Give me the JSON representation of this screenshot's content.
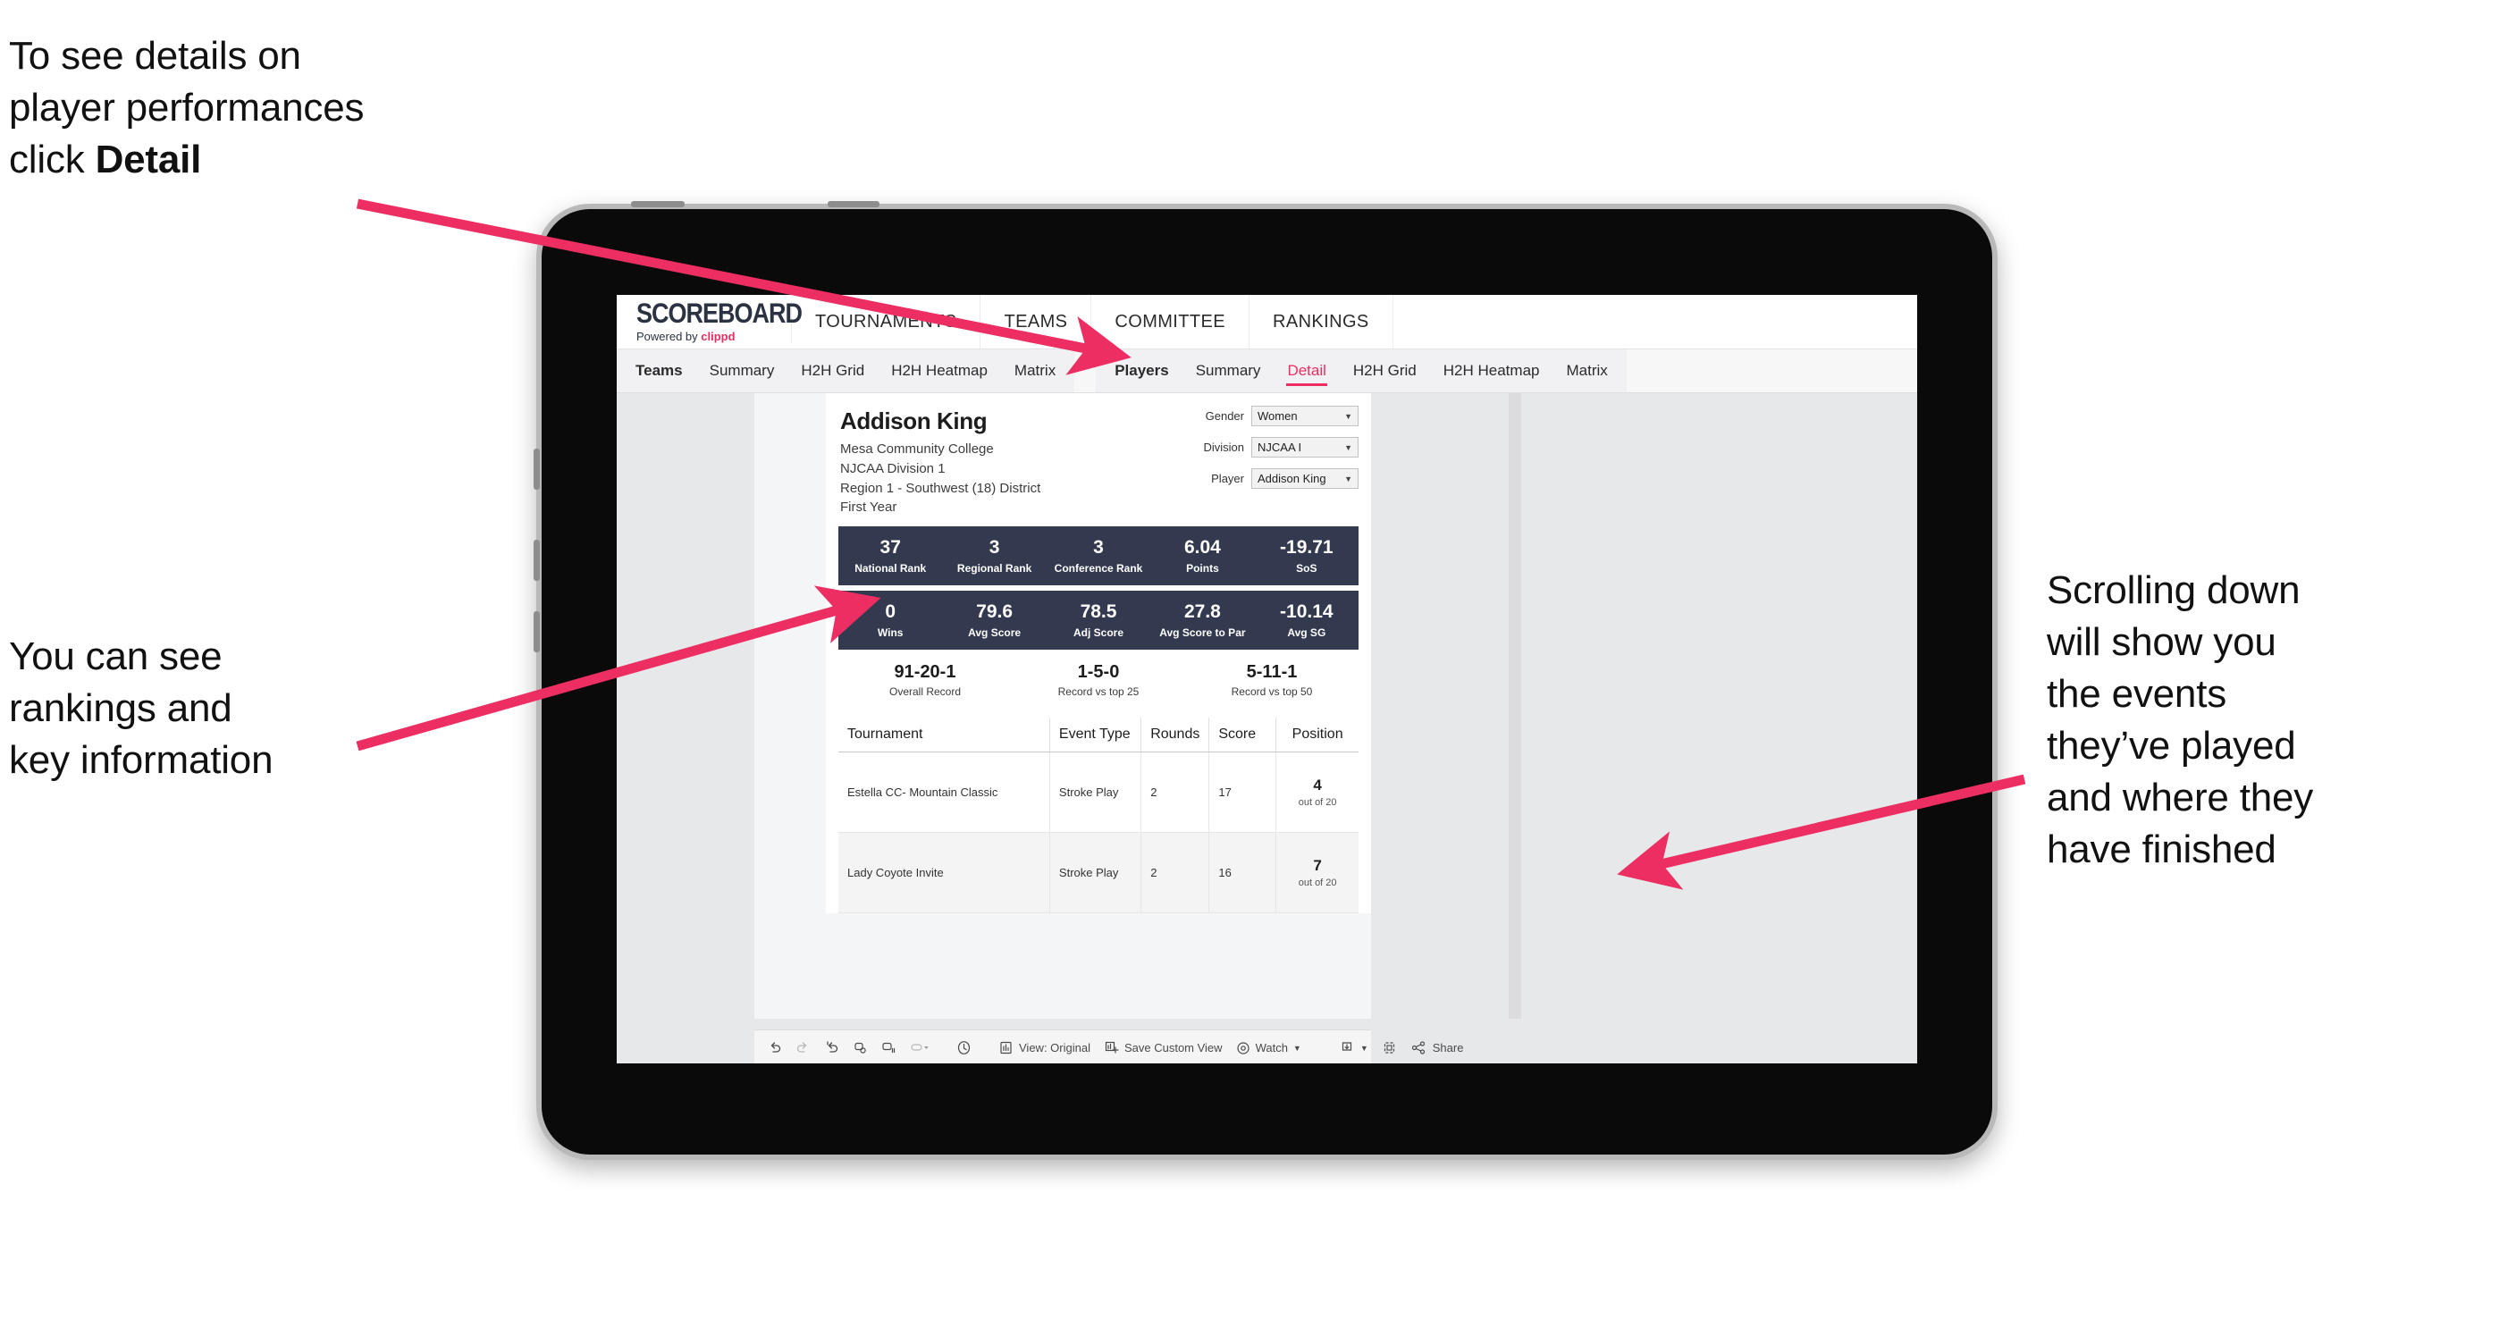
{
  "annotations": {
    "top_left": {
      "line1": "To see details on",
      "line2": "player performances",
      "line3_pre": "click ",
      "line3_bold": "Detail"
    },
    "bottom_left": {
      "line1": "You can see",
      "line2": "rankings and",
      "line3": "key information"
    },
    "right": {
      "line1": "Scrolling down",
      "line2": "will show you",
      "line3": "the events",
      "line4": "they’ve played",
      "line5": "and where they",
      "line6": "have finished"
    }
  },
  "colors": {
    "accent_pink": "#ec2e62",
    "stat_bar_navy": "#333a4f",
    "screen_bg": "#e7e8ea"
  },
  "app": {
    "brand": {
      "name": "SCOREBOARD",
      "tagline_pre": "Powered by ",
      "tagline_brand": "clippd"
    },
    "top_nav": [
      {
        "label": "TOURNAMENTS"
      },
      {
        "label": "TEAMS"
      },
      {
        "label": "COMMITTEE"
      },
      {
        "label": "RANKINGS"
      }
    ],
    "sub_nav": {
      "teams_group": [
        {
          "label": "Teams",
          "active": false,
          "head": true
        },
        {
          "label": "Summary",
          "active": false
        },
        {
          "label": "H2H Grid",
          "active": false
        },
        {
          "label": "H2H Heatmap",
          "active": false
        },
        {
          "label": "Matrix",
          "active": false
        }
      ],
      "players_group": [
        {
          "label": "Players",
          "active": false,
          "head": true
        },
        {
          "label": "Summary",
          "active": false
        },
        {
          "label": "Detail",
          "active": true
        },
        {
          "label": "H2H Grid",
          "active": false
        },
        {
          "label": "H2H Heatmap",
          "active": false
        },
        {
          "label": "Matrix",
          "active": false
        }
      ]
    },
    "player": {
      "name": "Addison King",
      "school": "Mesa Community College",
      "division": "NJCAA Division 1",
      "region": "Region 1 - Southwest (18) District",
      "year": "First Year"
    },
    "filters": [
      {
        "label": "Gender",
        "value": "Women"
      },
      {
        "label": "Division",
        "value": "NJCAA I"
      },
      {
        "label": "Player",
        "value": "Addison King"
      }
    ],
    "stats_row_1": [
      {
        "value": "37",
        "label": "National Rank"
      },
      {
        "value": "3",
        "label": "Regional Rank"
      },
      {
        "value": "3",
        "label": "Conference Rank"
      },
      {
        "value": "6.04",
        "label": "Points"
      },
      {
        "value": "-19.71",
        "label": "SoS"
      }
    ],
    "stats_row_2": [
      {
        "value": "0",
        "label": "Wins"
      },
      {
        "value": "79.6",
        "label": "Avg Score"
      },
      {
        "value": "78.5",
        "label": "Adj Score"
      },
      {
        "value": "27.8",
        "label": "Avg Score to Par"
      },
      {
        "value": "-10.14",
        "label": "Avg SG"
      }
    ],
    "records": [
      {
        "value": "91-20-1",
        "label": "Overall Record"
      },
      {
        "value": "1-5-0",
        "label": "Record vs top 25"
      },
      {
        "value": "5-11-1",
        "label": "Record vs top 50"
      }
    ],
    "events_table": {
      "columns": [
        "Tournament",
        "Event Type",
        "Rounds",
        "Score",
        "Position"
      ],
      "rows": [
        {
          "tournament": "Estella CC- Mountain Classic",
          "event_type": "Stroke Play",
          "rounds": "2",
          "score": "17",
          "position": "4",
          "position_sub": "out of 20"
        },
        {
          "tournament": "Lady Coyote Invite",
          "event_type": "Stroke Play",
          "rounds": "2",
          "score": "16",
          "position": "7",
          "position_sub": "out of 20"
        }
      ]
    },
    "toolbar": {
      "view_label": "View: Original",
      "save_label": "Save Custom View",
      "watch_label": "Watch",
      "share_label": "Share"
    }
  }
}
